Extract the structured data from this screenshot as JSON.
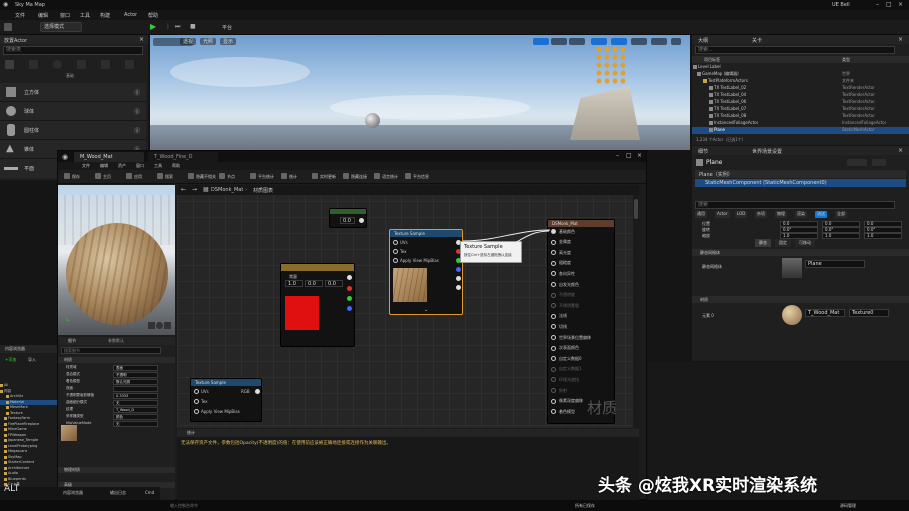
{
  "app": {
    "title_bar": {
      "project": "Sky Ma Map",
      "right": "UE Bell"
    },
    "menu": [
      "文件",
      "编辑",
      "窗口",
      "工具",
      "构建",
      "Actor",
      "帮助"
    ],
    "toolbar_mode": "选择模式",
    "toolbar_platforms": "平台"
  },
  "left_panel": {
    "title": "放置Actor",
    "search_placeholder": "搜索类",
    "tabs": [
      "基础",
      "灯光",
      "形状",
      "视觉效果",
      "体积",
      "所有类"
    ],
    "items": [
      {
        "label": "立方体"
      },
      {
        "label": "球体"
      },
      {
        "label": "圆柱体"
      },
      {
        "label": "锥体"
      },
      {
        "label": "平面"
      }
    ],
    "close": "×"
  },
  "outliner": {
    "tab1": "大纲",
    "tab2": "关卡",
    "search_placeholder": "搜索...",
    "col_label": "项目标签",
    "col_type": "类型",
    "rows": [
      {
        "label": "Level Label",
        "type": ""
      },
      {
        "label": "GameMap (编辑器)",
        "type": "世界"
      },
      {
        "label": "TestPlateformActors",
        "type": "文件夹"
      },
      {
        "label": "TX TestLabel_02",
        "type": "TextRenderActor"
      },
      {
        "label": "TX TestLabel_04",
        "type": "TextRenderActor"
      },
      {
        "label": "TX TestLabel_06",
        "type": "TextRenderActor"
      },
      {
        "label": "TX TestLabel_07",
        "type": "TextRenderActor"
      },
      {
        "label": "TX TestLabel_08",
        "type": "TextRenderActor"
      },
      {
        "label": "InstancedFoliageActor",
        "type": "InstancedFoliageActor"
      },
      {
        "label": "Plane",
        "type": "StaticMeshActor"
      }
    ],
    "footer": "1,234 个Actor（已选1个）"
  },
  "details": {
    "tab1": "细节",
    "tab2": "世界场景设置",
    "object": "Plane",
    "instance": "Plane（实例）",
    "component": "StaticMeshComponent (StaticMeshComponent0)",
    "search_placeholder": "搜索",
    "filter_tabs": [
      "通用",
      "Actor",
      "LOD",
      "杂项",
      "物理",
      "渲染",
      "流送",
      "全部"
    ],
    "rows": [
      {
        "label": "位置",
        "values": [
          "0.0",
          "0.0",
          "0.0"
        ]
      },
      {
        "label": "旋转",
        "values": [
          "0.0°",
          "0.0°",
          "0.0°"
        ]
      },
      {
        "label": "缩放",
        "values": [
          "1.0",
          "1.0",
          "1.0"
        ]
      }
    ],
    "mobility": [
      "静态",
      "固定",
      "可移动"
    ],
    "section_mesh": "静态网格体",
    "mesh_label": "静态网格体",
    "mesh_value": "Plane",
    "section_material": "材质",
    "material_slot": "元素 0",
    "material_value": "T_Wood_Mat",
    "material_extra": "Texture0"
  },
  "viewport": {
    "mode": "透视",
    "lit": "光照",
    "show": "显示"
  },
  "material_editor": {
    "title": "M_Wood_Mat",
    "tab2": "T_Wood_Fine_D",
    "menu": [
      "文件",
      "编辑",
      "资产",
      "窗口",
      "工具",
      "帮助"
    ],
    "toolbar": [
      "保存",
      "浏览",
      "应用",
      "搜索",
      "主页",
      "层级",
      "实时更新",
      "统计",
      "平台数据",
      "生成数据",
      "检查值大小",
      "显示冲突",
      "平台统计",
      "平行文件",
      "平台支持"
    ],
    "toolbar_visible": [
      "保存",
      "主页",
      "应用",
      "搜索",
      "隐藏不相关",
      "节点",
      "平台统计",
      "统计",
      "实时更新",
      "隐藏连接",
      "语言统计",
      "平台信息"
    ],
    "breadcrumb": "DSMonk_Mat",
    "breadcrumb2": "材质图表",
    "watermark": "材质",
    "nodes": {
      "const": {
        "title": "Constant",
        "value": "0.0"
      },
      "vector": {
        "title": "Constant3Vector",
        "label": "常量",
        "vals": [
          "1.0",
          "0.0",
          "0.0"
        ]
      },
      "tex1": {
        "title": "Texture Sample",
        "pins": [
          "UVs",
          "Tex",
          "Apply View MipBias"
        ],
        "outs": [
          "RGB",
          "R",
          "G",
          "B",
          "A",
          "RGBA"
        ]
      },
      "tex2": {
        "title": "Texture Sample",
        "pins": [
          "UVs",
          "Tex",
          "Apply View MipBias"
        ],
        "outs": [
          "RGB"
        ]
      },
      "main": {
        "title": "DSMonk_Mat",
        "pins": [
          "基础颜色",
          "金属度",
          "高光度",
          "粗糙度",
          "各向异性",
          "自发光颜色",
          "不透明度",
          "不透明蒙版",
          "法线",
          "切线",
          "世界场景位置偏移",
          "次表面颜色",
          "自定义数据0",
          "自定义数据1",
          "环境光遮挡",
          "折射",
          "像素深度偏移",
          "着色模型"
        ]
      }
    },
    "tooltip": {
      "title": "Texture Sample",
      "desc": "按住Ctrl+鼠标左键拖拽以连接"
    },
    "log_tab": "统计",
    "log_line": "无法保存资产文件，参数包括Opacity(不透明度)的值：在使用前应该被正确地连接或连接作为关联输出。"
  },
  "mat_details": {
    "tab": "细节",
    "tab2": "参数默认",
    "search_placeholder": "搜索细节",
    "sections": [
      "材质",
      "物理材质",
      "高级"
    ],
    "rows": [
      {
        "label": "材质域",
        "value": "表面"
      },
      {
        "label": "混合模式",
        "value": "不透明"
      },
      {
        "label": "着色模型",
        "value": "默认光照"
      },
      {
        "label": "双面",
        "value": ""
      },
      {
        "label": "不透明蒙版剪辑值",
        "value": "0.3333"
      },
      {
        "label": "曲面细分模式",
        "value": "无"
      },
      {
        "label": "纹理",
        "value": "T_Wood_D"
      },
      {
        "label": "采样器类型",
        "value": "颜色"
      },
      {
        "label": "MipValueMode",
        "value": "无"
      }
    ]
  },
  "content_browser": {
    "title": "内容浏览器",
    "add": "+添加",
    "import": "导入",
    "tree": [
      "All",
      "内容",
      "ArchViz",
      "Material",
      "MeshMark",
      "Texture",
      "FantasyFarm",
      "FirePlaceFireplace",
      "MineGame",
      "FPWeapon",
      "Japanese_Temple",
      "LevelPrototyping",
      "Megascans",
      "SkyMap",
      "StarterContent",
      "Architecture",
      "Audio",
      "Blueprints",
      "C++类"
    ],
    "bottom": [
      "内容浏览器",
      "输出日志",
      "Cmd"
    ],
    "command_placeholder": "输入控制台命令"
  },
  "status": {
    "alt": "ALT",
    "right": "所有已保存",
    "source": "源码管理"
  },
  "watermark": "头条 @炫我XR实时渲染系统",
  "colors": {
    "accent": "#0e79d8",
    "red_preview": "#e01010",
    "selection": "#1d4c84",
    "node_red": "#7a1b1b",
    "node_blue": "#1d4a6e"
  }
}
